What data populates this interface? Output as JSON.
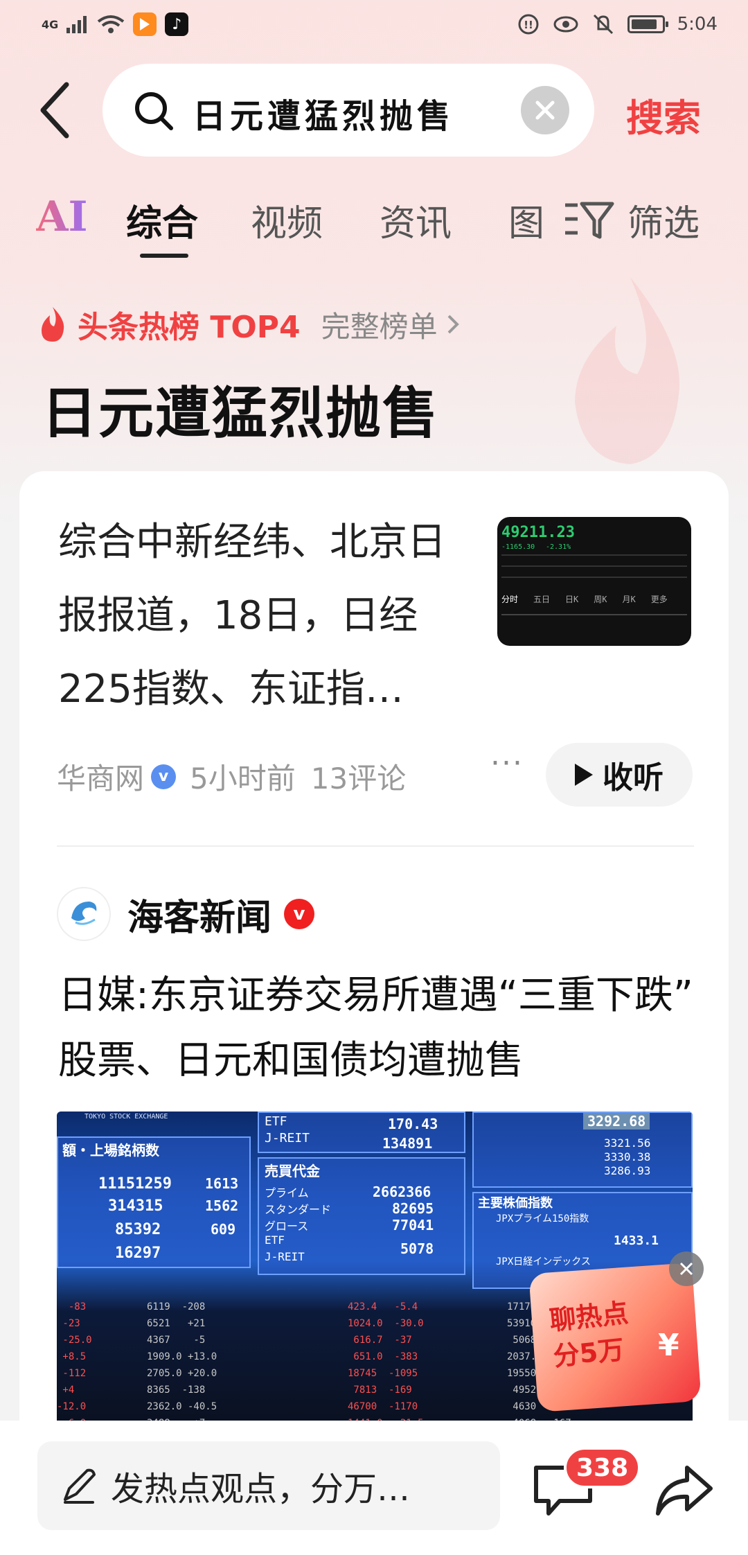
{
  "status_bar": {
    "network": "4G",
    "time": "5:04"
  },
  "search": {
    "query": "日元遭猛烈抛售",
    "submit_label": "搜索"
  },
  "tabs": [
    {
      "label": "AI"
    },
    {
      "label": "综合"
    },
    {
      "label": "视频"
    },
    {
      "label": "资讯"
    },
    {
      "label": "图"
    },
    {
      "label": "筛选"
    }
  ],
  "hot_rank": {
    "label": "头条热榜 TOP4",
    "full_list": "完整榜单",
    "topic_title": "日元遭猛烈抛售"
  },
  "article1": {
    "text": "综合中新经纬、北京日报报道，18日，日经225指数、东证指…",
    "source": "华商网",
    "time": "5小时前",
    "comments": "13评论",
    "listen_label": "收听",
    "thumb": {
      "price": "49211.23",
      "change": "-1165.30",
      "change_pct": "-2.31%",
      "tabs": [
        "分时",
        "五日",
        "日K",
        "周K",
        "月K",
        "更多"
      ]
    }
  },
  "article2": {
    "source": "海客新闻",
    "title": "日媒:东京证券交易所遭遇“三重下跌” 股票、日元和国债均遭抛售",
    "image_texts": {
      "exchange": "TOKYO STOCK EXCHANGE",
      "listed_issues": "額・上場銘柄数",
      "trading_value": "売買代金",
      "major_indices": "主要株価指数",
      "prime": "プライム",
      "standard": "スタンダード",
      "growth": "グロース",
      "etf": "ETF",
      "jreit": "J-REIT",
      "v1": "170.43",
      "v2": "134891",
      "v3": "2662366",
      "v4": "82695",
      "v5": "77041",
      "v6": "5078",
      "n1": "11151259",
      "n2": "314315",
      "n3": "85392",
      "n4": "16297",
      "c1": "1613",
      "c2": "1562",
      "c3": "609",
      "r1": "3292.68",
      "r2": "3321.56",
      "r3": "3330.38",
      "r4": "3286.93",
      "r5": "1433.1",
      "jpx150": "JPXプライム150指数",
      "jpx_nikkei": "JPX日経インデックス"
    }
  },
  "promo": {
    "text_line1": "聊热点",
    "text_line2": "分5万",
    "yen": "¥"
  },
  "bottom_bar": {
    "comment_placeholder": "发热点观点，分万…",
    "comment_count": "338"
  }
}
